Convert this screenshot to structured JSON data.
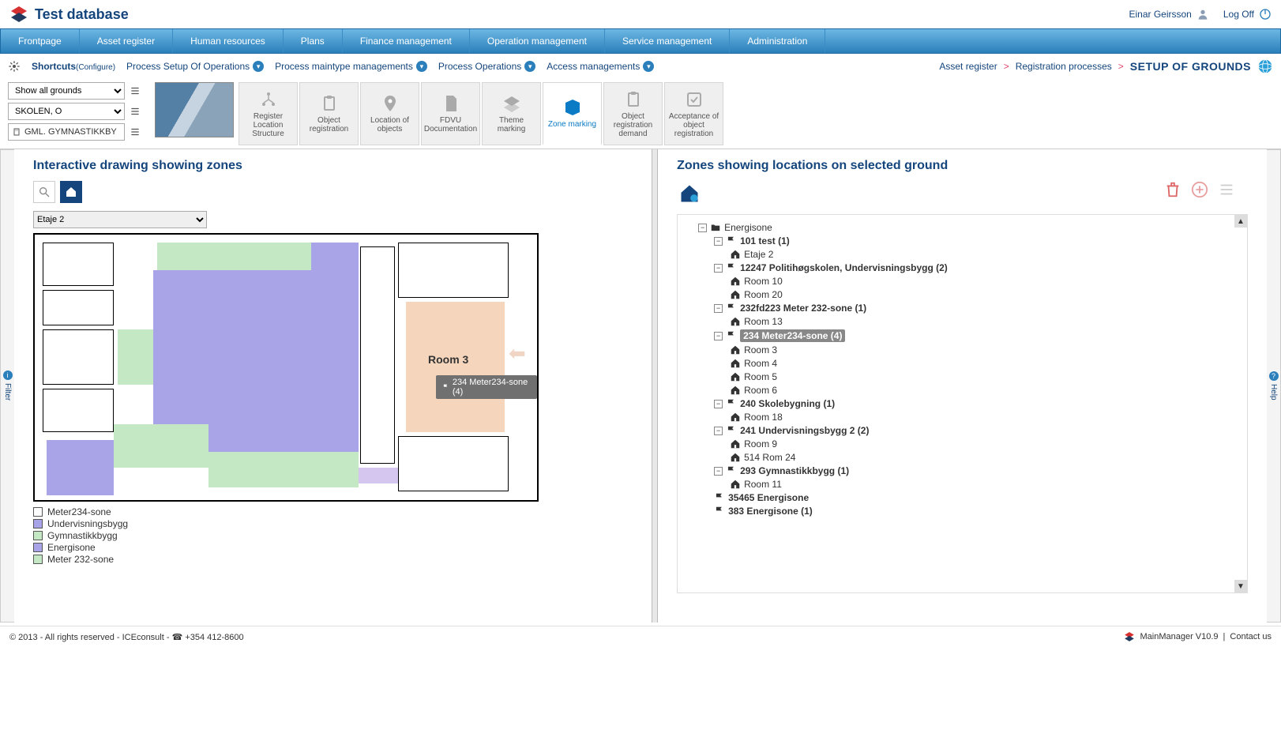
{
  "header": {
    "app_title": "Test database",
    "user_name": "Einar Geirsson",
    "logoff": "Log Off"
  },
  "main_nav": [
    "Frontpage",
    "Asset register",
    "Human resources",
    "Plans",
    "Finance management",
    "Operation management",
    "Service management",
    "Administration"
  ],
  "shortcuts": {
    "label": "Shortcuts",
    "configure": "(Configure)",
    "processes": [
      "Process Setup Of Operations",
      "Process maintype managements",
      "Process Operations",
      "Access managements"
    ]
  },
  "breadcrumb": {
    "items": [
      "Asset register",
      "Registration processes"
    ],
    "current": "SETUP OF GROUNDS"
  },
  "filters": {
    "show_all": "Show all grounds",
    "school": "SKOLEN, O",
    "building": "GML. GYMNASTIKKBY"
  },
  "tiles": [
    {
      "label": "Register Location Structure"
    },
    {
      "label": "Object registration"
    },
    {
      "label": "Location of objects"
    },
    {
      "label": "FDVU Documentation"
    },
    {
      "label": "Theme marking"
    },
    {
      "label": "Zone marking",
      "active": true
    },
    {
      "label": "Object registration demand"
    },
    {
      "label": "Acceptance of object registration"
    }
  ],
  "left_panel": {
    "title": "Interactive drawing showing zones",
    "floor_select": "Etaje 2",
    "room3": "Room 3",
    "tooltip": "234 Meter234-sone (4)",
    "legend": [
      {
        "label": "Meter234-sone",
        "color": "#ffffff"
      },
      {
        "label": "Undervisningsbygg",
        "color": "#a9a3e8"
      },
      {
        "label": "Gymnastikkbygg",
        "color": "#c4e8c4"
      },
      {
        "label": "Energisone",
        "color": "#a9a3e8"
      },
      {
        "label": "Meter 232-sone",
        "color": "#c4e8c4"
      }
    ]
  },
  "right_panel": {
    "title": "Zones showing locations on selected ground"
  },
  "tree": {
    "root": "Energisone",
    "nodes": [
      {
        "label": "101 test (1)",
        "icon": "flag-red",
        "bold": true,
        "children": [
          {
            "label": "Etaje 2",
            "icon": "house-yellow"
          }
        ]
      },
      {
        "label": "12247 Politihøgskolen, Undervisningsbygg (2)",
        "icon": "flag-blue",
        "bold": true,
        "children": [
          {
            "label": "Room 10",
            "icon": "house-green"
          },
          {
            "label": "Room 20",
            "icon": "house-green"
          }
        ]
      },
      {
        "label": "232fd223 Meter 232-sone (1)",
        "icon": "flag-blue",
        "bold": true,
        "children": [
          {
            "label": "Room 13",
            "icon": "house-green"
          }
        ]
      },
      {
        "label": "234 Meter234-sone (4)",
        "icon": "flag-blue",
        "bold": true,
        "selected": true,
        "children": [
          {
            "label": "Room 3",
            "icon": "house-green"
          },
          {
            "label": "Room 4",
            "icon": "house-green"
          },
          {
            "label": "Room 5",
            "icon": "house-green"
          },
          {
            "label": "Room 6",
            "icon": "house-green"
          }
        ]
      },
      {
        "label": "240 Skolebygning (1)",
        "icon": "flag-blue",
        "bold": true,
        "children": [
          {
            "label": "Room 18",
            "icon": "house-green"
          }
        ]
      },
      {
        "label": "241 Undervisningsbygg 2 (2)",
        "icon": "flag-blue",
        "bold": true,
        "children": [
          {
            "label": "Room 9",
            "icon": "house-green"
          },
          {
            "label": "514 Rom 24",
            "icon": "house-green"
          }
        ]
      },
      {
        "label": "293 Gymnastikkbygg (1)",
        "icon": "flag-blue",
        "bold": true,
        "children": [
          {
            "label": "Room 11",
            "icon": "house-green"
          }
        ]
      },
      {
        "label": "35465 Energisone",
        "icon": "flag-blue",
        "bold": true
      },
      {
        "label": "383 Energisone (1)",
        "icon": "flag-blue",
        "bold": true
      }
    ]
  },
  "side_tabs": {
    "filter": "Filter",
    "help": "Help"
  },
  "footer": {
    "copyright": "© 2013 - All rights reserved - ICEconsult - ☎ +354 412-8600",
    "version": "MainManager V10.9",
    "contact": "Contact us"
  }
}
